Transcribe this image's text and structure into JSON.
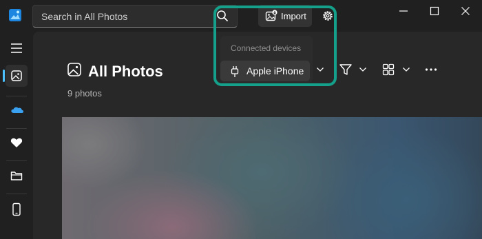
{
  "app": {
    "accent": "#4cc2ff",
    "highlight": "#14a08a"
  },
  "search": {
    "placeholder": "Search in All Photos"
  },
  "toolbar": {
    "import_label": "Import"
  },
  "devices": {
    "header": "Connected devices",
    "items": [
      {
        "label": "Apple iPhone"
      }
    ]
  },
  "gallery": {
    "title": "All Photos",
    "count": "9 photos"
  },
  "sidebar": {
    "items": [
      "menu",
      "all-photos",
      "onedrive",
      "favorites",
      "folders",
      "phone"
    ]
  }
}
